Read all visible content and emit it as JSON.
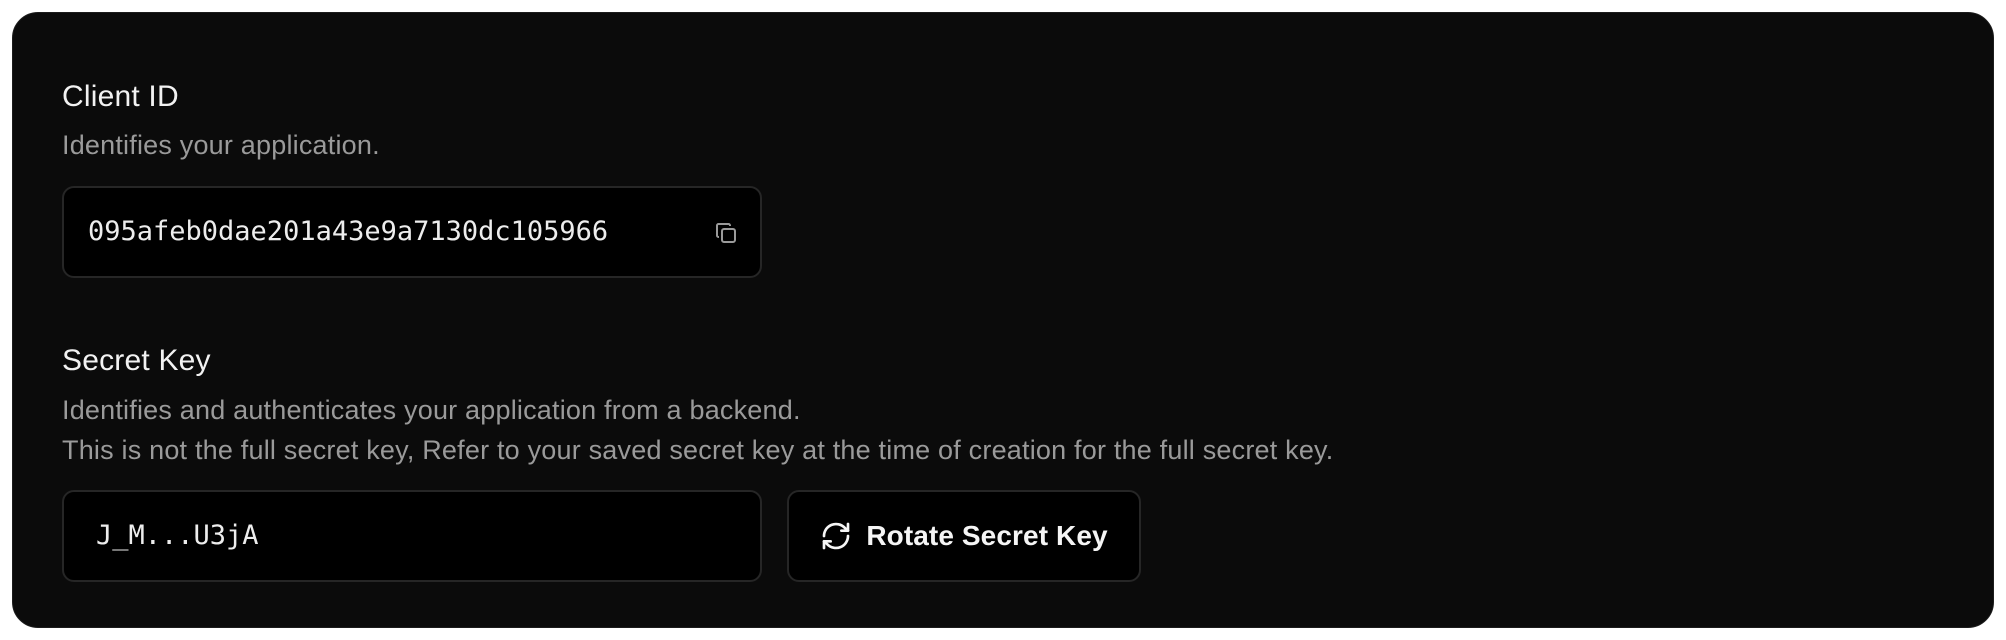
{
  "client_id": {
    "title": "Client ID",
    "description": "Identifies your application.",
    "value": "095afeb0dae201a43e9a7130dc105966",
    "copy_icon": "copy-icon"
  },
  "secret_key": {
    "title": "Secret Key",
    "description_line1": "Identifies and authenticates your application from a backend.",
    "description_line2": "This is not the full secret key, Refer to your saved secret key at the time of creation for the full secret key.",
    "value": "J_M...U3jA",
    "rotate_label": "Rotate Secret Key",
    "rotate_icon": "refresh-icon"
  }
}
